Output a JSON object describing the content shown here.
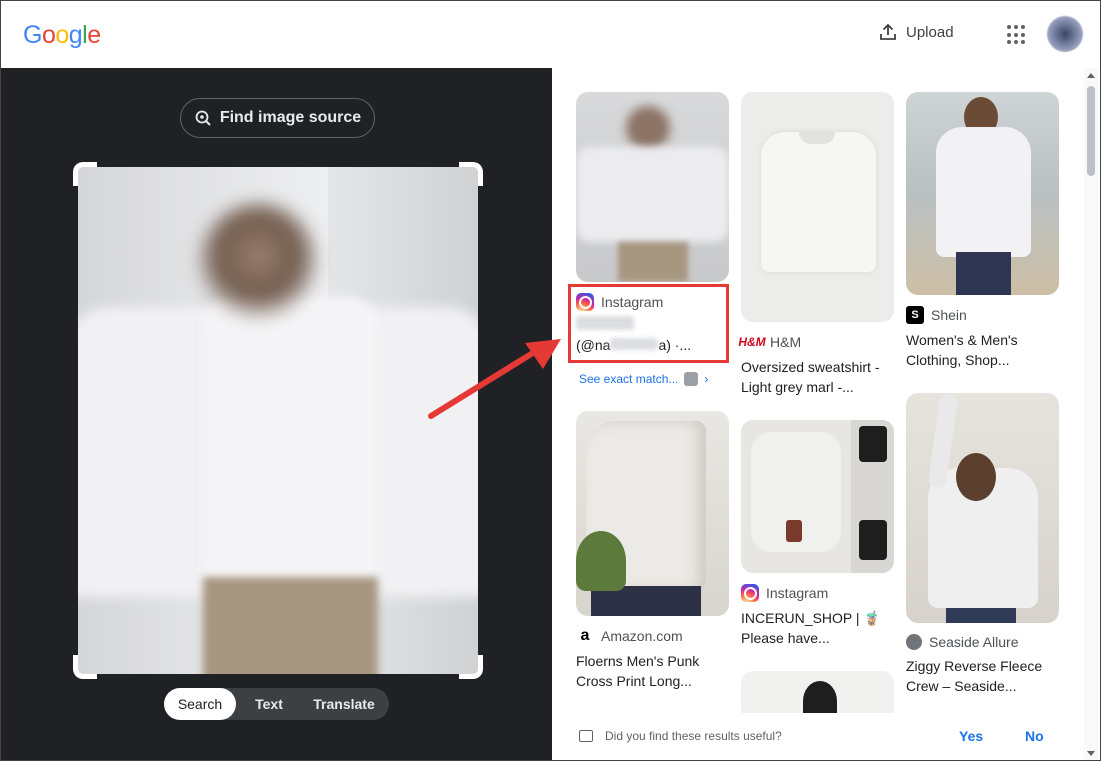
{
  "header": {
    "logo_letters": [
      "G",
      "o",
      "o",
      "g",
      "l",
      "e"
    ],
    "logo_colors": [
      "#4285F4",
      "#EA4335",
      "#FBBC05",
      "#4285F4",
      "#34A853",
      "#EA4335"
    ],
    "upload_label": "Upload"
  },
  "lens": {
    "find_source_label": "Find image source",
    "modes": [
      {
        "label": "Search",
        "active": true
      },
      {
        "label": "Text",
        "active": false
      },
      {
        "label": "Translate",
        "active": false
      }
    ]
  },
  "results": {
    "col1": [
      {
        "source": "Instagram",
        "source_icon": "instagram-icon",
        "title_line1": "(@na",
        "title_line2_suffix": "a) ·...",
        "see_exact": "See exact match..."
      },
      {
        "source": "Amazon.com",
        "source_icon": "amazon-icon",
        "title": "Floerns Men's Punk Cross Print Long..."
      }
    ],
    "col2": [
      {
        "source": "H&M",
        "source_icon": "hm-icon",
        "title": "Oversized sweatshirt - Light grey marl -..."
      },
      {
        "source": "Instagram",
        "source_icon": "instagram-icon",
        "title": "INCERUN_SHOP | 🧋 Please have..."
      }
    ],
    "col3": [
      {
        "source": "Shein",
        "source_icon": "shein-icon",
        "title": "Women's & Men's Clothing, Shop..."
      },
      {
        "source": "Seaside Allure",
        "source_icon": "globe-icon",
        "title": "Ziggy Reverse Fleece Crew – Seaside..."
      }
    ]
  },
  "feedback": {
    "question": "Did you find these results useful?",
    "yes": "Yes",
    "no": "No"
  },
  "colors": {
    "accent": "#1a73e8",
    "highlight": "#e53935",
    "dark_panel": "#202124"
  }
}
